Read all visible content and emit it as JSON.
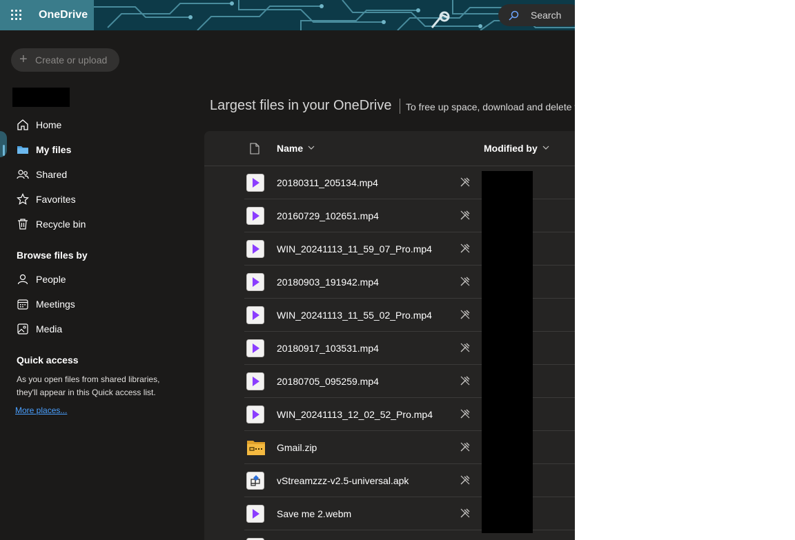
{
  "header": {
    "app_title": "OneDrive",
    "search_label": "Search",
    "brand_color": "#3a7c8b"
  },
  "left_nav": {
    "create_label": "Create or upload",
    "items": [
      {
        "label": "Home",
        "icon": "home-icon"
      },
      {
        "label": "My files",
        "icon": "folder-icon",
        "selected": true
      },
      {
        "label": "Shared",
        "icon": "people-shared-icon"
      },
      {
        "label": "Favorites",
        "icon": "star-icon"
      },
      {
        "label": "Recycle bin",
        "icon": "trash-icon"
      }
    ],
    "browse_title": "Browse files by",
    "browse_items": [
      {
        "label": "People",
        "icon": "person-icon"
      },
      {
        "label": "Meetings",
        "icon": "calendar-icon"
      },
      {
        "label": "Media",
        "icon": "image-icon"
      }
    ],
    "quick_access_title": "Quick access",
    "quick_access_desc": "As you open files from shared libraries, they'll appear in this Quick access list.",
    "more_places": "More places..."
  },
  "main": {
    "title": "Largest files in your OneDrive",
    "subtitle": "To free up space, download and delete t",
    "columns": {
      "name": "Name",
      "modified_by": "Modified by"
    },
    "files": [
      {
        "name": "20180311_205134.mp4",
        "type": "video"
      },
      {
        "name": "20160729_102651.mp4",
        "type": "video"
      },
      {
        "name": "WIN_20241113_11_59_07_Pro.mp4",
        "type": "video"
      },
      {
        "name": "20180903_191942.mp4",
        "type": "video"
      },
      {
        "name": "WIN_20241113_11_55_02_Pro.mp4",
        "type": "video"
      },
      {
        "name": "20180917_103531.mp4",
        "type": "video"
      },
      {
        "name": "20180705_095259.mp4",
        "type": "video"
      },
      {
        "name": "WIN_20241113_12_02_52_Pro.mp4",
        "type": "video"
      },
      {
        "name": "Gmail.zip",
        "type": "zip"
      },
      {
        "name": "vStreamzzz-v2.5-universal.apk",
        "type": "apk"
      },
      {
        "name": "Save me 2.webm",
        "type": "video"
      },
      {
        "name": "",
        "type": "video"
      }
    ]
  }
}
